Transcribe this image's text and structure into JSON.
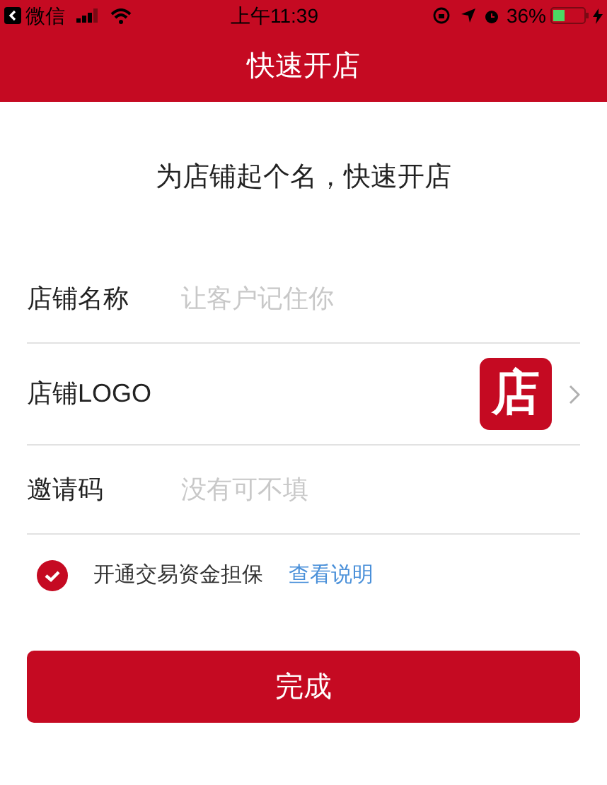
{
  "status_bar": {
    "back_app": "微信",
    "time": "上午11:39",
    "battery": "36%"
  },
  "nav": {
    "title": "快速开店"
  },
  "heading": "为店铺起个名，快速开店",
  "fields": [
    {
      "kind": "input",
      "label": "店铺名称",
      "placeholder": "让客户记住你"
    },
    {
      "kind": "logo",
      "label": "店铺LOGO",
      "logo_text": "店"
    },
    {
      "kind": "input",
      "label": "邀请码",
      "placeholder": "没有可不填"
    }
  ],
  "agreement": {
    "checked": true,
    "text": "开通交易资金担保",
    "link": "查看说明"
  },
  "submit": "完成"
}
